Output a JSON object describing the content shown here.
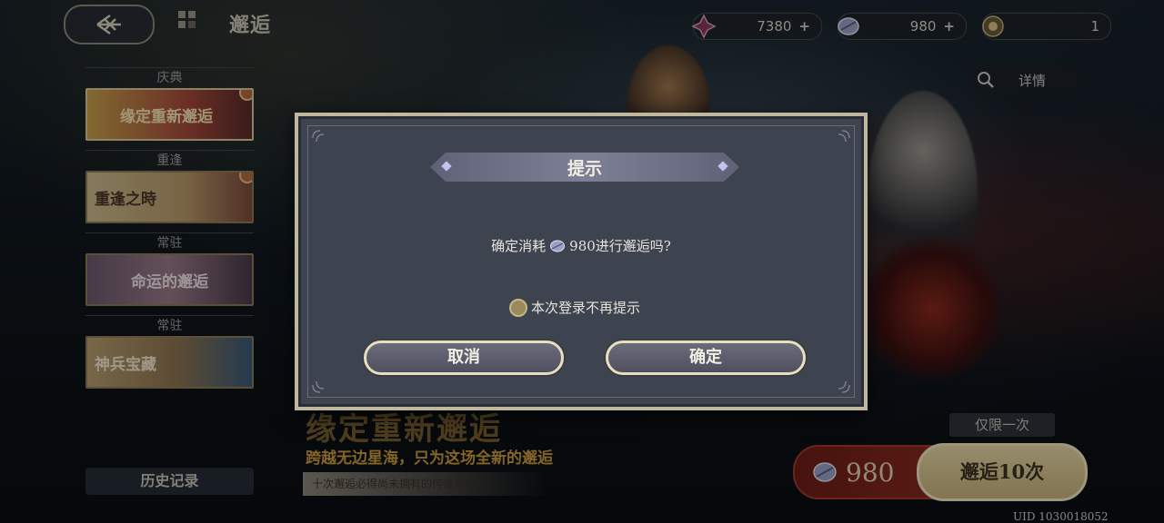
{
  "header": {
    "title": "邂逅"
  },
  "currencies": [
    {
      "icon": "star-crystal-icon",
      "value": "7380",
      "plus": "+"
    },
    {
      "icon": "feather-gem-icon",
      "value": "980",
      "plus": "+"
    },
    {
      "icon": "summon-token-icon",
      "value": "1"
    }
  ],
  "details_label": "详情",
  "sidebar": {
    "groups": [
      {
        "category": "庆典",
        "banner": "缘定重新邂逅"
      },
      {
        "category": "重逢",
        "banner": "重逢之時"
      },
      {
        "category": "常驻",
        "banner": "命运的邂逅"
      },
      {
        "category": "常驻",
        "banner": "神兵宝藏"
      }
    ],
    "history": "历史记录"
  },
  "event": {
    "title": "缘定重新邂逅",
    "subtitle": "跨越无边星海，只为这场全新的邂逅",
    "note": "十次邂逅必得尚未拥有的传说角色"
  },
  "summon": {
    "limit_tag": "仅限一次",
    "cost": "980",
    "button": "邂逅10次"
  },
  "uid": "UID 1030018052",
  "dialog": {
    "title": "提示",
    "message_prefix": "确定消耗",
    "message_cost": "980",
    "message_suffix": "进行邂逅吗?",
    "checkbox_label": "本次登录不再提示",
    "cancel": "取消",
    "confirm": "确定"
  },
  "colors": {
    "accent_gold": "#e8dfbd",
    "dialog_bg": "#3e4350",
    "cost_red": "#8a2a20"
  }
}
